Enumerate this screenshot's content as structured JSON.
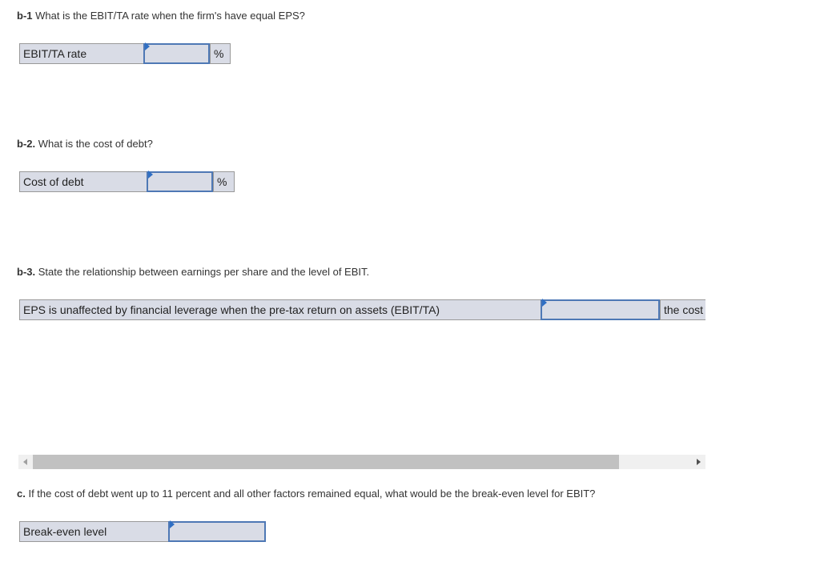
{
  "b1": {
    "prefix": "b-1",
    "question": " What is the EBIT/TA rate when the firm's have equal EPS?",
    "label": "EBIT/TA rate",
    "value": "",
    "unit": "%"
  },
  "b2": {
    "prefix": "b-2.",
    "question": " What is the cost of debt?",
    "label": "Cost of debt",
    "value": "",
    "unit": "%"
  },
  "b3": {
    "prefix": "b-3.",
    "question": " State the relationship between earnings per share and the level of EBIT.",
    "label": "EPS is unaffected by financial leverage when the pre-tax return on assets (EBIT/TA)",
    "value": "",
    "suffix": "the cost"
  },
  "c": {
    "prefix": "c.",
    "question": " If the cost of debt went up to 11 percent and all other factors remained equal, what would be the break-even level for EBIT?",
    "label": "Break-even level",
    "value": ""
  }
}
